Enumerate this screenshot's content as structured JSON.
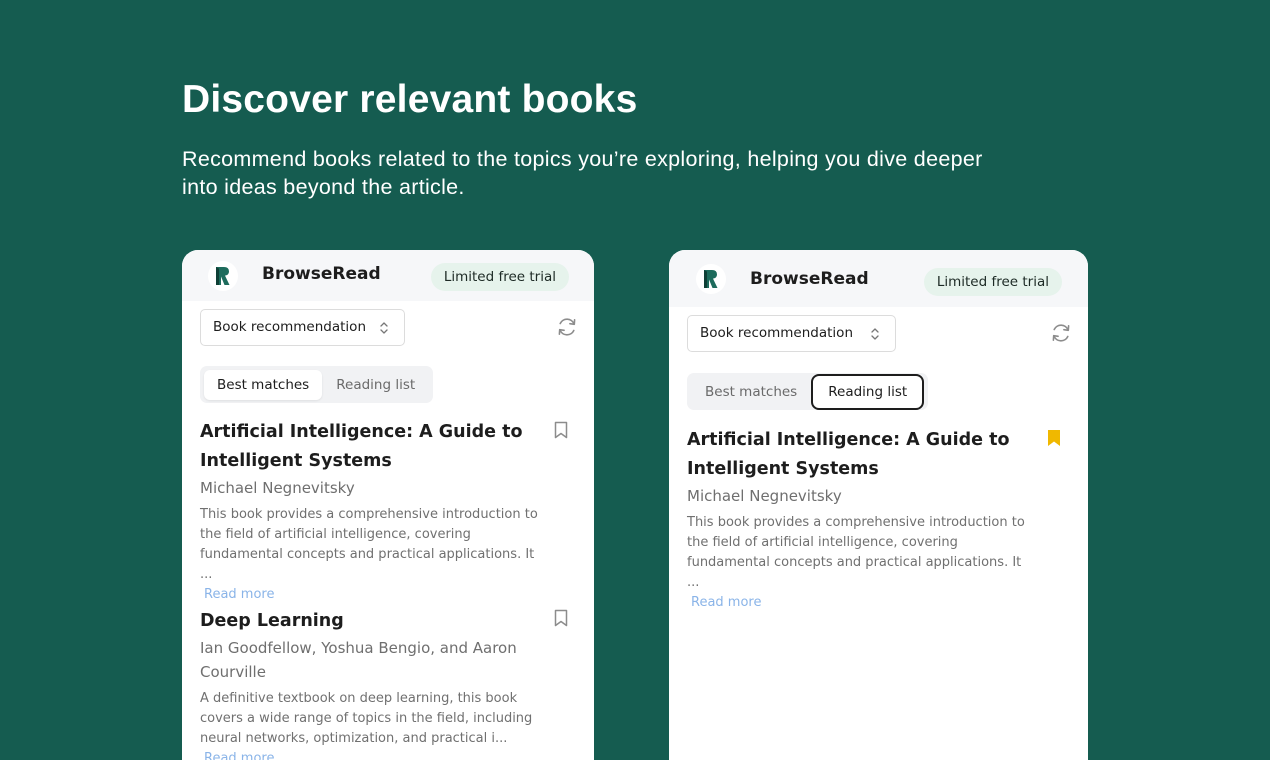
{
  "hero": {
    "title": "Discover relevant books",
    "subtitle": "Recommend books related to the topics you’re exploring, helping you dive deeper into ideas beyond the article."
  },
  "colors": {
    "background": "#155c50",
    "brand_green": "#1d6b5c",
    "badge_bg": "#e6f3ec",
    "link": "#8ab4e8",
    "bookmark_active": "#f0b800"
  },
  "panels": [
    {
      "brand": "BrowseRead",
      "badge": "Limited free trial",
      "select_value": "Book recommendation",
      "tabs": [
        "Best matches",
        "Reading list"
      ],
      "active_tab": "Best matches",
      "books": [
        {
          "title": "Artificial Intelligence: A Guide to Intelligent Systems",
          "author": "Michael Negnevitsky",
          "description": "This book provides a comprehensive introduction to the field of artificial intelligence, covering fundamental concepts and practical applications. It ...",
          "read_more": "Read more",
          "bookmarked": false
        },
        {
          "title": "Deep Learning",
          "author": "Ian Goodfellow, Yoshua Bengio, and Aaron Courville",
          "description": "A definitive textbook on deep learning, this book covers a wide range of topics in the field, including neural networks, optimization, and practical i...",
          "read_more": "Read more",
          "bookmarked": false
        }
      ]
    },
    {
      "brand": "BrowseRead",
      "badge": "Limited free trial",
      "select_value": "Book recommendation",
      "tabs": [
        "Best matches",
        "Reading list"
      ],
      "active_tab": "Reading list",
      "books": [
        {
          "title": "Artificial Intelligence: A Guide to Intelligent Systems",
          "author": "Michael Negnevitsky",
          "description": "This book provides a comprehensive introduction to the field of artificial intelligence, covering fundamental concepts and practical applications. It ...",
          "read_more": "Read more",
          "bookmarked": true
        }
      ]
    }
  ]
}
